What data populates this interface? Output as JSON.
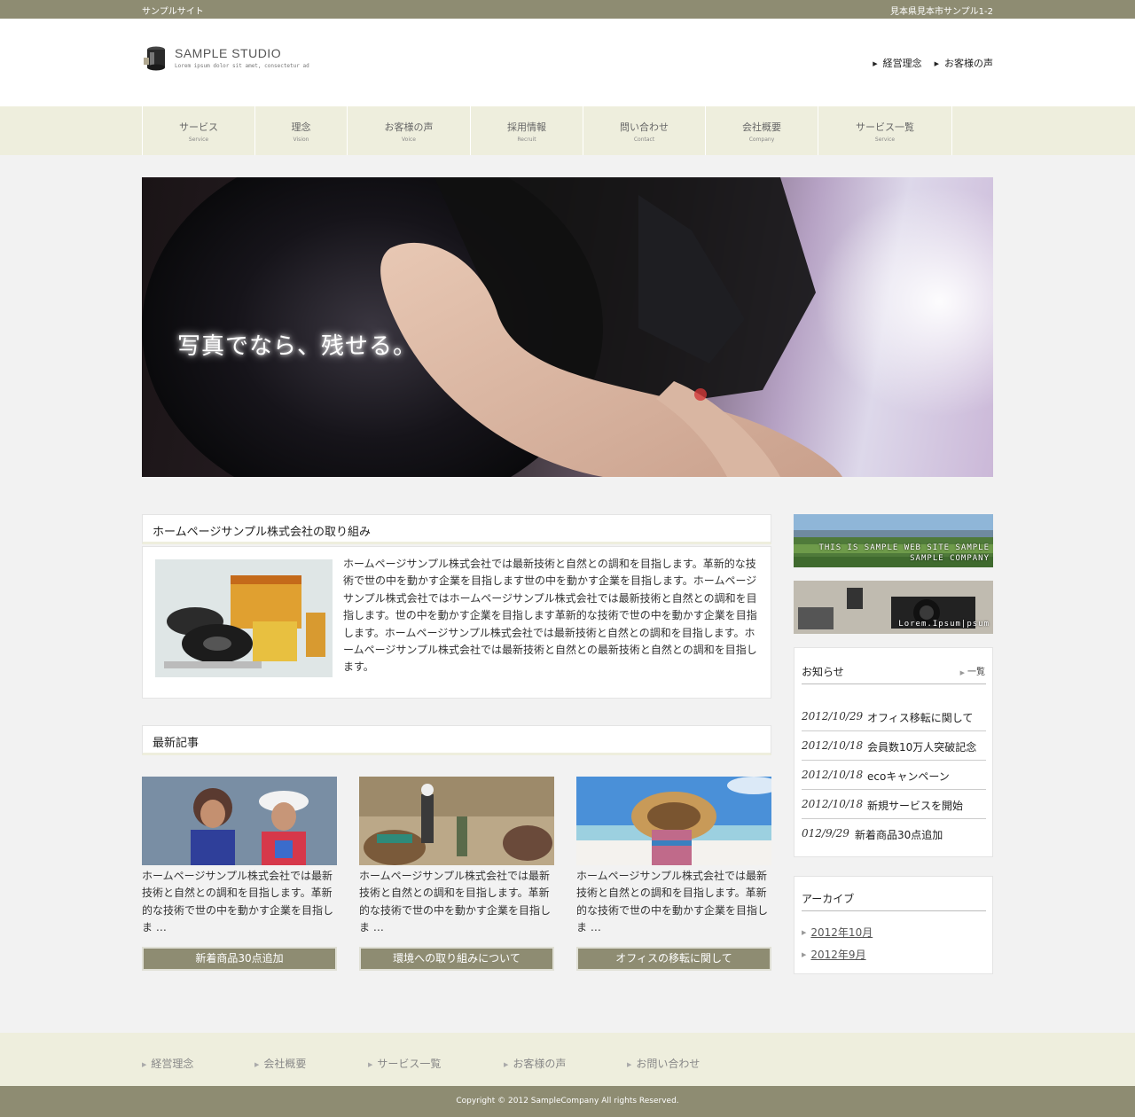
{
  "topbar": {
    "site_label": "サンプルサイト",
    "address": "見本県見本市サンプル1-2"
  },
  "header": {
    "logo_title": "SAMPLE STUDIO",
    "logo_sub": "Lorem ipsum dolor sit amet, consectetur ad",
    "links": [
      "経営理念",
      "お客様の声"
    ]
  },
  "gnav": [
    {
      "ja": "サービス",
      "en": "Service"
    },
    {
      "ja": "理念",
      "en": "Vision"
    },
    {
      "ja": "お客様の声",
      "en": "Voice"
    },
    {
      "ja": "採用情報",
      "en": "Recruit"
    },
    {
      "ja": "問い合わせ",
      "en": "Contact"
    },
    {
      "ja": "会社概要",
      "en": "Company"
    },
    {
      "ja": "サービス一覧",
      "en": "Service"
    }
  ],
  "hero": {
    "copy": "写真でなら、残せる。"
  },
  "about": {
    "heading": "ホームページサンプル株式会社の取り組み",
    "body": "ホームページサンプル株式会社では最新技術と自然との調和を目指します。革新的な技術で世の中を動かす企業を目指します世の中を動かす企業を目指します。ホームページサンプル株式会社ではホームページサンプル株式会社では最新技術と自然との調和を目指します。世の中を動かす企業を目指します革新的な技術で世の中を動かす企業を目指します。ホームページサンプル株式会社では最新技術と自然との調和を目指します。ホームページサンプル株式会社では最新技術と自然との最新技術と自然との調和を目指します。"
  },
  "latest": {
    "heading": "最新記事",
    "cards": [
      {
        "text": "ホームページサンプル株式会社では最新技術と自然との調和を目指します。革新的な技術で世の中を動かす企業を目指しま …",
        "button": "新着商品30点追加"
      },
      {
        "text": "ホームページサンプル株式会社では最新技術と自然との調和を目指します。革新的な技術で世の中を動かす企業を目指しま …",
        "button": "環境への取り組みについて"
      },
      {
        "text": "ホームページサンプル株式会社では最新技術と自然との調和を目指します。革新的な技術で世の中を動かす企業を目指しま …",
        "button": "オフィスの移転に関して"
      }
    ]
  },
  "sidebar": {
    "banner1_lines": [
      "THIS IS SAMPLE WEB SITE SAMPLE",
      "SAMPLE COMPANY"
    ],
    "banner2_text": "Lorem.Ipsum|psum",
    "news": {
      "title": "お知らせ",
      "more": "一覧",
      "items": [
        {
          "date": "2012/10/29",
          "title": "オフィス移転に関して"
        },
        {
          "date": "2012/10/18",
          "title": "会員数10万人突破記念"
        },
        {
          "date": "2012/10/18",
          "title": "ecoキャンペーン"
        },
        {
          "date": "2012/10/18",
          "title": "新規サービスを開始"
        },
        {
          "date": "012/9/29",
          "title": "新着商品30点追加"
        }
      ]
    },
    "archive": {
      "title": "アーカイブ",
      "items": [
        "2012年10月",
        "2012年9月"
      ]
    }
  },
  "footer": {
    "links": [
      "経営理念",
      "会社概要",
      "サービス一覧",
      "お客様の声",
      "お問い合わせ"
    ],
    "copyright": "Copyright © 2012 SampleCompany All rights Reserved."
  },
  "colors": {
    "accent": "#8e8c72",
    "nav_bg": "#eeeedd",
    "page_bg": "#f2f2f2"
  }
}
